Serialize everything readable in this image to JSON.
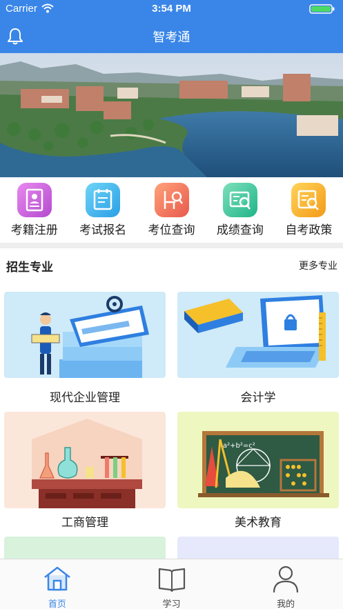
{
  "status_bar": {
    "carrier": "Carrier",
    "time": "3:54 PM"
  },
  "header": {
    "title": "智考通"
  },
  "quick_actions": [
    {
      "label": "考籍注册",
      "icon": "id-card-icon",
      "color": "#d060d8"
    },
    {
      "label": "考试报名",
      "icon": "clipboard-icon",
      "color": "#3fb3ee"
    },
    {
      "label": "考位查询",
      "icon": "chair-search-icon",
      "color": "#f07a60"
    },
    {
      "label": "成绩查询",
      "icon": "score-search-icon",
      "color": "#35c29a"
    },
    {
      "label": "自考政策",
      "icon": "policy-search-icon",
      "color": "#f7b52c"
    }
  ],
  "section": {
    "title": "招生专业",
    "more_label": "更多专业"
  },
  "majors": [
    {
      "name": "现代企业管理"
    },
    {
      "name": "会计学"
    },
    {
      "name": "工商管理"
    },
    {
      "name": "美术教育"
    }
  ],
  "tabbar": {
    "items": [
      {
        "label": "首页",
        "icon": "home-icon",
        "active": true
      },
      {
        "label": "学习",
        "icon": "book-icon",
        "active": false
      },
      {
        "label": "我的",
        "icon": "user-icon",
        "active": false
      }
    ]
  },
  "colors": {
    "primary": "#3a86e8"
  }
}
